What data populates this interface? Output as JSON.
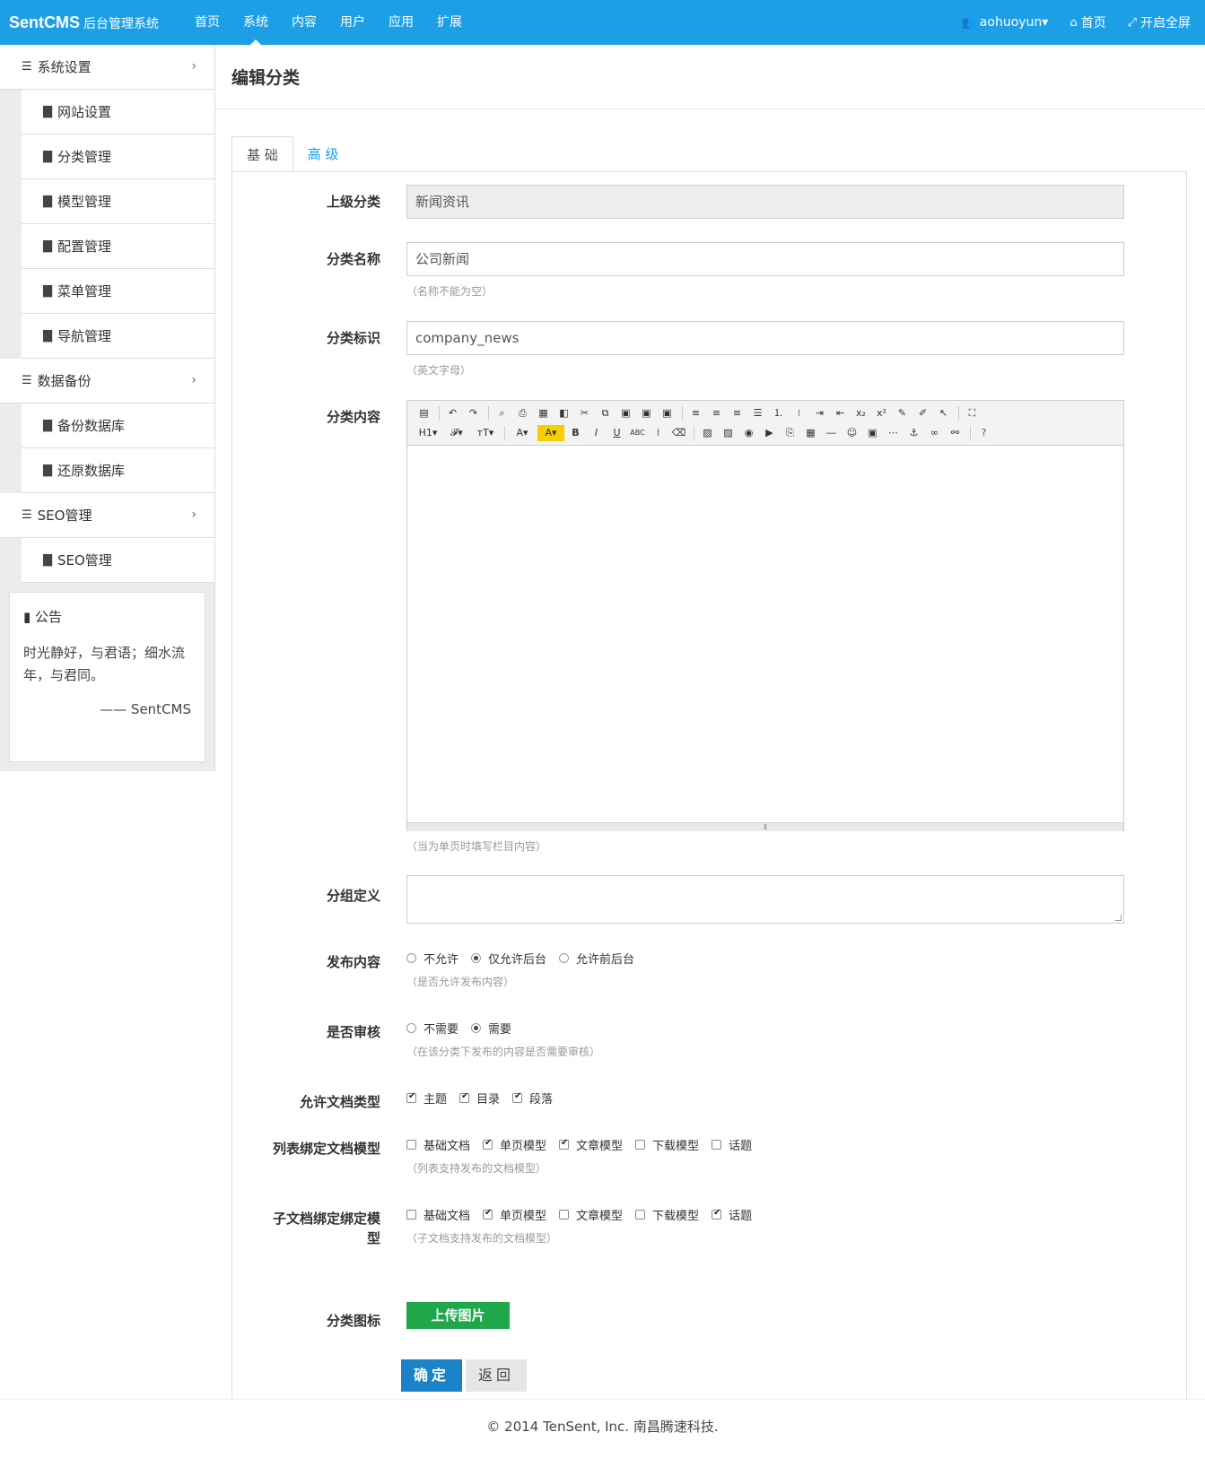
{
  "header": {
    "brand": "SentCMS",
    "brand_sub": "后台管理系统",
    "nav": [
      "首页",
      "系统",
      "内容",
      "用户",
      "应用",
      "扩展"
    ],
    "user": "aohuoyun",
    "home": "首页",
    "fullscreen": "开启全屏"
  },
  "sidebar": {
    "groups": [
      {
        "label": "系统设置",
        "items": [
          "网站设置",
          "分类管理",
          "模型管理",
          "配置管理",
          "菜单管理",
          "导航管理"
        ]
      },
      {
        "label": "数据备份",
        "items": [
          "备份数据库",
          "还原数据库"
        ]
      },
      {
        "label": "SEO管理",
        "items": [
          "SEO管理"
        ]
      }
    ],
    "notice": {
      "title": "公告",
      "body": "时光静好，与君语；细水流年，与君同。",
      "sign": "—— SentCMS"
    }
  },
  "page": {
    "title": "编辑分类",
    "tabs": [
      "基 础",
      "高 级"
    ]
  },
  "form": {
    "parent": {
      "label": "上级分类",
      "value": "新闻资讯"
    },
    "name": {
      "label": "分类名称",
      "value": "公司新闻",
      "help": "（名称不能为空）"
    },
    "ident": {
      "label": "分类标识",
      "value": "company_news",
      "help": "（英文字母）"
    },
    "content": {
      "label": "分类内容",
      "help": "（当为单页时填写栏目内容）"
    },
    "group": {
      "label": "分组定义"
    },
    "publish": {
      "label": "发布内容",
      "options": [
        "不允许",
        "仅允许后台",
        "允许前后台"
      ],
      "selected": 1,
      "help": "（是否允许发布内容）"
    },
    "review": {
      "label": "是否审核",
      "options": [
        "不需要",
        "需要"
      ],
      "selected": 1,
      "help": "（在该分类下发布的内容是否需要审核）"
    },
    "doctype": {
      "label": "允许文档类型",
      "options": [
        "主题",
        "目录",
        "段落"
      ],
      "checked": [
        true,
        true,
        true
      ]
    },
    "list_model": {
      "label": "列表绑定文档模型",
      "options": [
        "基础文档",
        "单页模型",
        "文章模型",
        "下载模型",
        "话题"
      ],
      "checked": [
        false,
        true,
        true,
        false,
        false
      ],
      "help": "（列表支持发布的文档模型）"
    },
    "child_model": {
      "label_line1": "子文档绑定绑定模",
      "label_line2": "型",
      "options": [
        "基础文档",
        "单页模型",
        "文章模型",
        "下载模型",
        "话题"
      ],
      "checked": [
        false,
        true,
        false,
        false,
        true
      ],
      "help": "（子文档支持发布的文档模型）"
    },
    "icon": {
      "label": "分类图标",
      "upload": "上传图片"
    },
    "ok": "确定",
    "back": "返回"
  },
  "footer": "© 2014 TenSent, Inc. 南昌腾速科技."
}
